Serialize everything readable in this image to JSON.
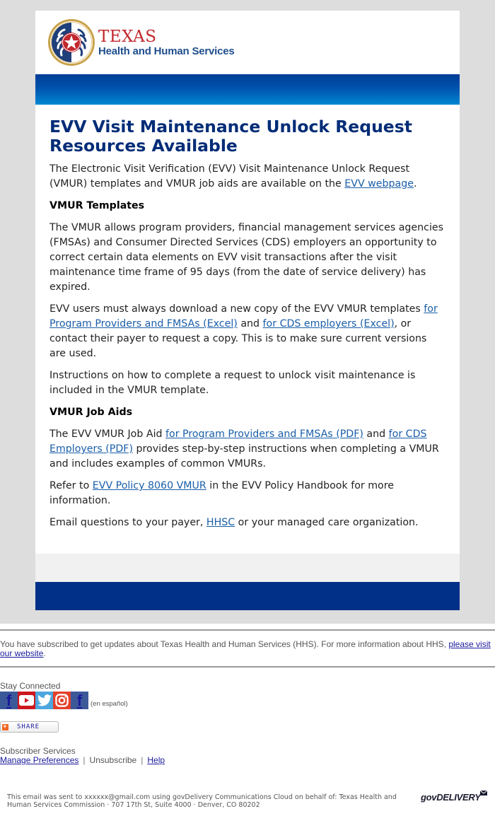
{
  "header": {
    "logo_alt": "seal-logo",
    "brand_line1": "TEXAS",
    "brand_line2": "Health and Human Services"
  },
  "colors": {
    "page_bg": "#dddddd",
    "title": "#002c77",
    "link": "#1a5ea8",
    "brand_red": "#c1272d",
    "brand_blue": "#1f4e8c",
    "navy_band": "#003087",
    "grey_band": "#f1f1f1"
  },
  "article": {
    "title": "EVV Visit Maintenance Unlock Request Resources Available",
    "intro": {
      "text_before": "The Electronic Visit Verification (EVV) Visit Maintenance Unlock Request (VMUR) templates and VMUR job aids are available on the ",
      "link": "EVV webpage",
      "text_after": "."
    },
    "section1_heading": "VMUR Templates",
    "section1_p1": "The VMUR allows program providers, financial management services agencies (FMSAs) and Consumer Directed Services (CDS) employers an opportunity to correct certain data elements on EVV visit transactions after the visit maintenance time frame of 95 days (from the date of service delivery) has expired.",
    "section1_p2": {
      "text1": "EVV users must always download a new copy of the EVV VMUR templates ",
      "link1": "for Program Providers and FMSAs (Excel)",
      "text2": " and ",
      "link2": "for CDS employers (Excel)",
      "text3": ", or contact their payer to request a copy. This is to make sure current versions are used."
    },
    "section1_p3": "Instructions on how to complete a request to unlock visit maintenance is included in the VMUR template.",
    "section2_heading": "VMUR Job Aids",
    "section2_p1": {
      "text1": "The EVV VMUR Job Aid ",
      "link1": "for Program Providers and FMSAs (PDF)",
      "text2": " and ",
      "link2": "for CDS Employers (PDF)",
      "text3": " provides step-by-step instructions when completing a VMUR and includes examples of common VMURs."
    },
    "section2_p2": {
      "text1": "Refer to ",
      "link1": "EVV Policy 8060 VMUR",
      "text2": " in the EVV Policy Handbook for more information."
    },
    "section2_p3": {
      "text1": "Email questions to your payer, ",
      "link1": "HHSC",
      "text2": " or your managed care organization."
    }
  },
  "footer": {
    "subscription_text": "You have subscribed to get updates about Texas Health and Human Services (HHS). For more information about HHS, ",
    "subscription_link": "please visit our website",
    "subscription_end": ".",
    "stay_connected": "Stay Connected",
    "social": [
      {
        "name": "facebook",
        "glyph": "f"
      },
      {
        "name": "youtube",
        "glyph": "▶"
      },
      {
        "name": "twitter",
        "glyph": "t"
      },
      {
        "name": "instagram",
        "glyph": "◎"
      },
      {
        "name": "facebook-espanol",
        "glyph": "f"
      }
    ],
    "espanol": "(en español)",
    "share_label": "SHARE",
    "subscriber_services": "Subscriber Services",
    "manage_preferences": "Manage Preferences",
    "unsubscribe": "Unsubscribe",
    "help": "Help",
    "separator": "|",
    "legal": "This email was sent to xxxxxx@gmail.com using govDelivery Communications Cloud on behalf of: Texas Health and Human Services Commission · 707 17th St, Suite 4000 · Denver, CO 80202",
    "govdelivery_logo": "govDELIVERY"
  }
}
